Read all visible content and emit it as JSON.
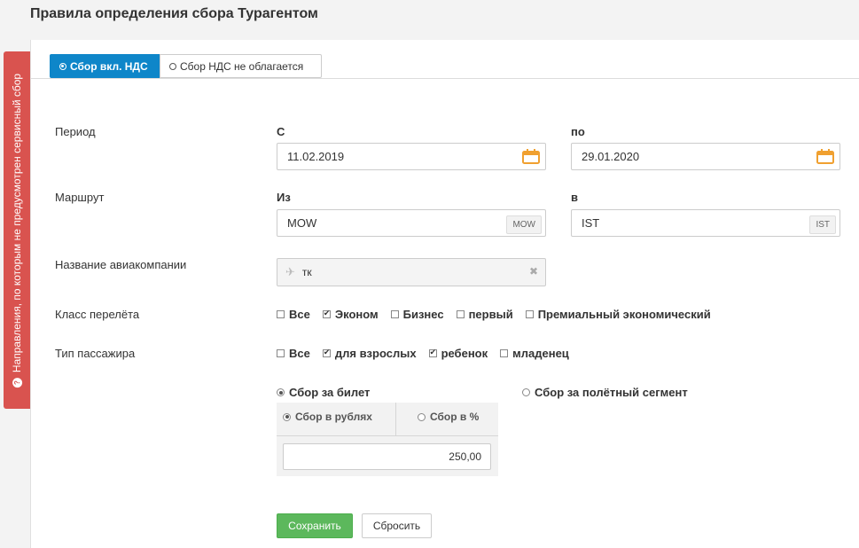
{
  "page": {
    "title": "Правила определения сбора Турагентом"
  },
  "side_panel": {
    "label": "Направления, по которым не предусмотрен сервисный сбор",
    "icon": "question-circle-icon"
  },
  "tabs": [
    {
      "label": "Сбор вкл. НДС",
      "active": true
    },
    {
      "label": "Сбор НДС не облагается",
      "active": false
    }
  ],
  "period": {
    "label": "Период",
    "from_label": "С",
    "from_value": "11.02.2019",
    "to_label": "по",
    "to_value": "29.01.2020"
  },
  "route": {
    "label": "Маршрут",
    "from_label": "Из",
    "from_value": "MOW",
    "from_code": "MOW",
    "to_label": "в",
    "to_value": "IST",
    "to_code": "IST"
  },
  "airline": {
    "label": "Название авиакомпании",
    "value": "тк"
  },
  "flight_class": {
    "label": "Класс перелёта",
    "options": [
      {
        "label": "Все",
        "checked": false
      },
      {
        "label": "Эконом",
        "checked": true
      },
      {
        "label": "Бизнес",
        "checked": false
      },
      {
        "label": "первый",
        "checked": false
      },
      {
        "label": "Премиальный экономический",
        "checked": false
      }
    ]
  },
  "passenger_type": {
    "label": "Тип пассажира",
    "options": [
      {
        "label": "Все",
        "checked": false
      },
      {
        "label": "для взрослых",
        "checked": true
      },
      {
        "label": "ребенок",
        "checked": true
      },
      {
        "label": "младенец",
        "checked": false
      }
    ]
  },
  "fee_mode": {
    "per_ticket": {
      "label": "Сбор за билет",
      "selected": true
    },
    "per_segment": {
      "label": "Сбор за полётный сегмент",
      "selected": false
    }
  },
  "fee_unit": {
    "rubles": {
      "label": "Сбор в рублях",
      "selected": true
    },
    "percent": {
      "label": "Сбор в %",
      "selected": false
    },
    "value": "250,00"
  },
  "buttons": {
    "save": "Сохранить",
    "reset": "Сбросить"
  },
  "colors": {
    "primary": "#0e86c9",
    "danger": "#d9534f",
    "success": "#5cb85c",
    "calendar": "#f0a030"
  }
}
